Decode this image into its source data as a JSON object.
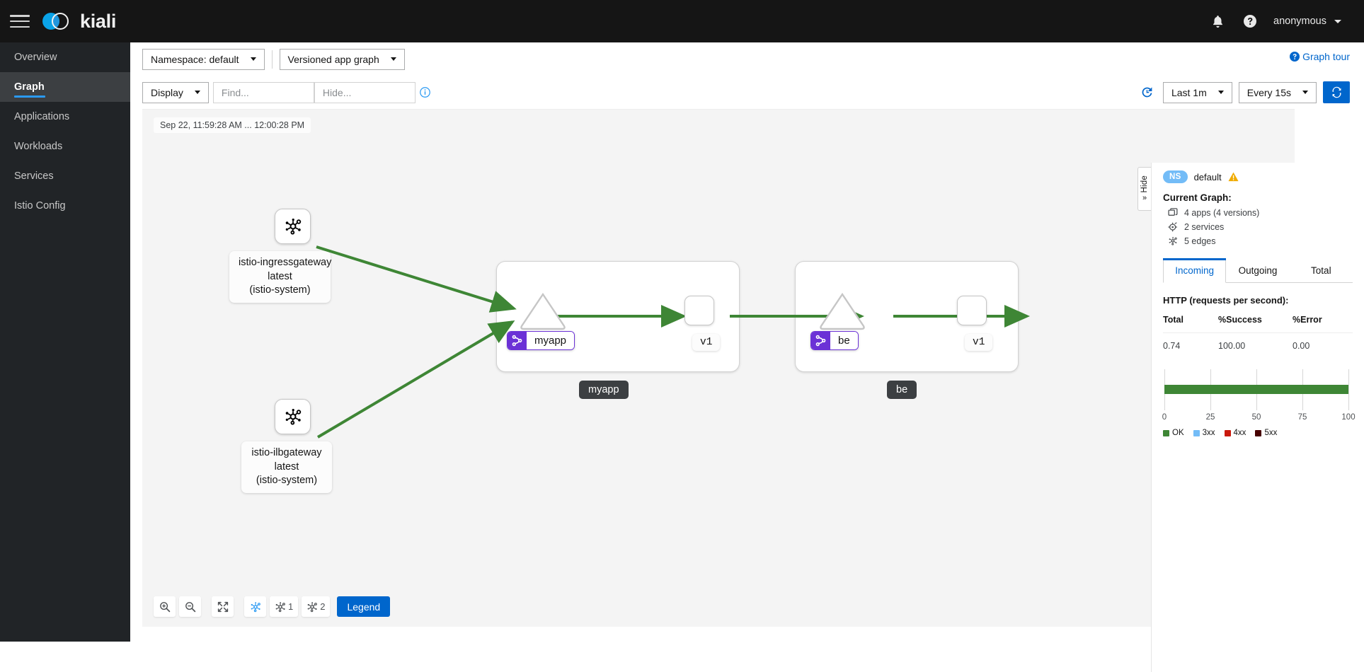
{
  "masthead": {
    "menu_icon": "hamburger-icon",
    "brand": "kiali",
    "notifications_icon": "bell-icon",
    "help_icon": "help-circle-icon",
    "user": "anonymous"
  },
  "sidebar": {
    "items": [
      {
        "label": "Overview",
        "active": false
      },
      {
        "label": "Graph",
        "active": true
      },
      {
        "label": "Applications",
        "active": false
      },
      {
        "label": "Workloads",
        "active": false
      },
      {
        "label": "Services",
        "active": false
      },
      {
        "label": "Istio Config",
        "active": false
      }
    ]
  },
  "toolbar": {
    "namespace_select": "Namespace: default",
    "graph_type_select": "Versioned app graph",
    "display_select": "Display",
    "find_placeholder": "Find...",
    "hide_placeholder": "Hide...",
    "info_icon": "info-circle-icon",
    "graph_tour": "Graph tour",
    "graph_tour_icon": "help-circle-icon",
    "replay_icon": "history-replay-icon",
    "duration_select": "Last 1m",
    "refresh_interval_select": "Every 15s",
    "refresh_icon": "sync-refresh-icon"
  },
  "graph": {
    "timestamp": "Sep 22, 11:59:28 AM ... 12:00:28 PM",
    "edge_color": "#3e8635",
    "nodes": {
      "ingressgateway": {
        "icon": "topology-mesh-icon",
        "label_line1": "istio-ingressgateway",
        "label_line2": "latest",
        "label_line3": "(istio-system)"
      },
      "ilbgateway": {
        "icon": "topology-mesh-icon",
        "label_line1": "istio-ilbgateway",
        "label_line2": "latest",
        "label_line3": "(istio-system)"
      },
      "myapp": {
        "group_label": "myapp",
        "app_badge_label": "myapp",
        "app_badge_icon": "virtual-service-route-icon",
        "app_badge_color": "#6b31d6",
        "version_label": "v1"
      },
      "be": {
        "group_label": "be",
        "app_badge_label": "be",
        "app_badge_icon": "virtual-service-route-icon",
        "app_badge_color": "#6b31d6",
        "version_label": "v1"
      }
    },
    "bottom_toolbar": {
      "zoom_in_icon": "zoom-in-icon",
      "zoom_out_icon": "zoom-out-icon",
      "fit_icon": "expand-fit-icon",
      "layout_default_icon": "topology-layout-icon",
      "layout1_icon": "topology-layout-icon",
      "layout1_label": "1",
      "layout2_icon": "topology-layout-icon",
      "layout2_label": "2",
      "legend_button": "Legend"
    }
  },
  "side_panel": {
    "hide_label": "Hide",
    "hide_chevron": "»",
    "ns_badge": "NS",
    "ns_name": "default",
    "warning_icon": "warning-triangle-icon",
    "current_graph_title": "Current Graph:",
    "stats": [
      {
        "icon": "applications-icon",
        "label": "4 apps (4 versions)"
      },
      {
        "icon": "services-icon",
        "label": "2 services"
      },
      {
        "icon": "edges-icon",
        "label": "5 edges"
      }
    ],
    "tabs": [
      {
        "label": "Incoming",
        "active": true
      },
      {
        "label": "Outgoing",
        "active": false
      },
      {
        "label": "Total",
        "active": false
      }
    ],
    "http_title": "HTTP (requests per second):",
    "metric_headers": {
      "total": "Total",
      "success": "%Success",
      "error": "%Error"
    },
    "metric_values": {
      "total": "0.74",
      "success": "100.00",
      "error": "0.00"
    }
  },
  "chart_data": {
    "type": "bar",
    "orientation": "horizontal",
    "title": "",
    "categories": [
      "HTTP"
    ],
    "series": [
      {
        "name": "OK",
        "values": [
          100
        ],
        "color": "#3e8635"
      },
      {
        "name": "3xx",
        "values": [
          0
        ],
        "color": "#73bcf7"
      },
      {
        "name": "4xx",
        "values": [
          0
        ],
        "color": "#c9190b"
      },
      {
        "name": "5xx",
        "values": [
          0
        ],
        "color": "#470000"
      }
    ],
    "xlabel": "",
    "ylabel": "",
    "xlim": [
      0,
      100
    ],
    "xticks": [
      0,
      25,
      50,
      75,
      100
    ],
    "xtick_labels": [
      "0",
      "25",
      "50",
      "75",
      "100"
    ],
    "grid": true,
    "legend_position": "bottom",
    "legend_entries": [
      "OK",
      "3xx",
      "4xx",
      "5xx"
    ]
  }
}
